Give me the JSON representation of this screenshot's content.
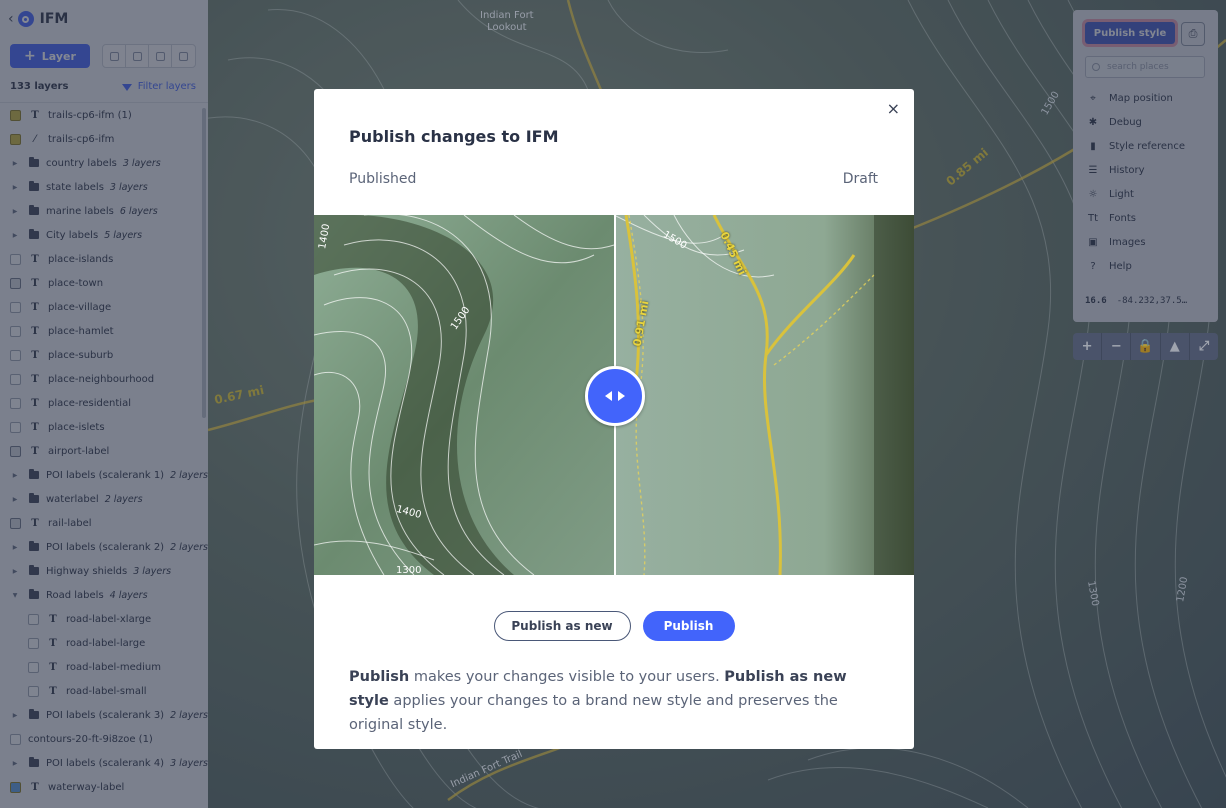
{
  "app": {
    "title": "IFM"
  },
  "sidebar": {
    "add_layer_label": "Layer",
    "layer_count": "133 layers",
    "filter_label": "Filter layers",
    "layers": [
      {
        "name": "trails-cp6-ifm (1)",
        "kind": "symbol",
        "swatch": "#c9b43c"
      },
      {
        "name": "trails-cp6-ifm",
        "kind": "line",
        "swatch": "#c9b43c"
      },
      {
        "name": "country labels",
        "kind": "group",
        "count": "3 layers"
      },
      {
        "name": "state labels",
        "kind": "group",
        "count": "3 layers"
      },
      {
        "name": "marine labels",
        "kind": "group",
        "count": "6 layers"
      },
      {
        "name": "City labels",
        "kind": "group",
        "count": "5 layers"
      },
      {
        "name": "place-islands",
        "kind": "symbol"
      },
      {
        "name": "place-town",
        "kind": "symbol",
        "swatch": "image"
      },
      {
        "name": "place-village",
        "kind": "symbol"
      },
      {
        "name": "place-hamlet",
        "kind": "symbol"
      },
      {
        "name": "place-suburb",
        "kind": "symbol"
      },
      {
        "name": "place-neighbourhood",
        "kind": "symbol"
      },
      {
        "name": "place-residential",
        "kind": "symbol"
      },
      {
        "name": "place-islets",
        "kind": "symbol"
      },
      {
        "name": "airport-label",
        "kind": "symbol",
        "swatch": "image"
      },
      {
        "name": "POI labels (scalerank 1)",
        "kind": "group",
        "count": "2 layers"
      },
      {
        "name": "waterlabel",
        "kind": "group",
        "count": "2 layers"
      },
      {
        "name": "rail-label",
        "kind": "symbol",
        "swatch": "image"
      },
      {
        "name": "POI labels (scalerank 2)",
        "kind": "group",
        "count": "2 layers"
      },
      {
        "name": "Highway shields",
        "kind": "group",
        "count": "3 layers"
      },
      {
        "name": "Road labels",
        "kind": "group",
        "count": "4 layers",
        "expanded": true
      },
      {
        "name": "road-label-xlarge",
        "kind": "symbol",
        "child": true
      },
      {
        "name": "road-label-large",
        "kind": "symbol",
        "child": true
      },
      {
        "name": "road-label-medium",
        "kind": "symbol",
        "child": true
      },
      {
        "name": "road-label-small",
        "kind": "symbol",
        "child": true
      },
      {
        "name": "POI labels (scalerank 3)",
        "kind": "group",
        "count": "2 layers"
      },
      {
        "name": "contours-20-ft-9i8zoe (1)",
        "kind": "none"
      },
      {
        "name": "POI labels (scalerank 4)",
        "kind": "group",
        "count": "3 layers"
      },
      {
        "name": "waterway-label",
        "kind": "symbol",
        "swatch": "#5b9be0"
      }
    ]
  },
  "controls": {
    "publish_style_label": "Publish style",
    "search_placeholder": "search places",
    "items": [
      {
        "label": "Map position",
        "icon": "crosshair-icon",
        "glyph": "⌖"
      },
      {
        "label": "Debug",
        "icon": "bug-icon",
        "glyph": "✱"
      },
      {
        "label": "Style reference",
        "icon": "book-icon",
        "glyph": "▮"
      },
      {
        "label": "History",
        "icon": "history-icon",
        "glyph": "☰"
      },
      {
        "label": "Light",
        "icon": "sun-icon",
        "glyph": "☼"
      },
      {
        "label": "Fonts",
        "icon": "font-icon",
        "glyph": "Tt"
      },
      {
        "label": "Images",
        "icon": "image-icon",
        "glyph": "▣"
      },
      {
        "label": "Help",
        "icon": "help-icon",
        "glyph": "?"
      }
    ],
    "zoom": "16.6",
    "coords": "-84.232,37.5…",
    "map_buttons": [
      {
        "name": "zoom-in-button",
        "glyph": "+"
      },
      {
        "name": "zoom-out-button",
        "glyph": "−"
      },
      {
        "name": "lock-button",
        "glyph": "🔒"
      },
      {
        "name": "north-arrow-button",
        "glyph": "▲"
      },
      {
        "name": "fullscreen-button",
        "glyph": "⤢"
      }
    ]
  },
  "map_labels": {
    "lookout": "Indian Fort\nLookout",
    "trail": "Indian Fort Trail",
    "dist_067": "0.67 mi",
    "dist_085": "0.85 mi",
    "elev_1500": "1500",
    "elev_1300": "1300",
    "elev_1200": "1200"
  },
  "modal": {
    "title": "Publish changes to IFM",
    "compare_left": "Published",
    "compare_right": "Draft",
    "image_labels": {
      "c1400a": "1400",
      "c1500a": "1500",
      "c1400b": "1400",
      "c1300": "1300",
      "c1500b": "1500",
      "d091": "0.91 mi",
      "d045": "0.45 mi"
    },
    "publish_as_new_label": "Publish as new",
    "publish_label": "Publish",
    "desc_b1": "Publish",
    "desc_t1": " makes your changes visible to your users. ",
    "desc_b2": "Publish as new style",
    "desc_t2": " applies your changes to a brand new style and preserves the original style."
  },
  "colors": {
    "accent": "#4264fb",
    "trail_yellow": "#d7c23a"
  }
}
